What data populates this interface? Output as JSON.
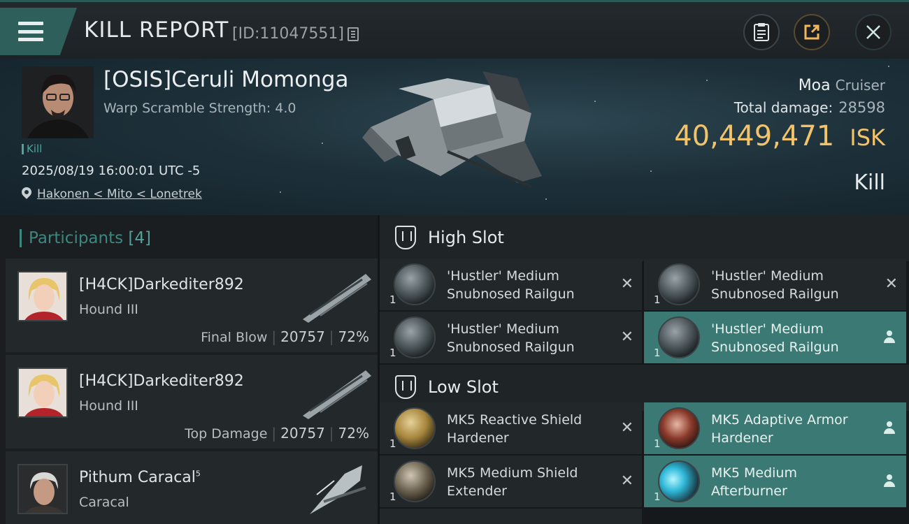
{
  "topbar": {
    "title": "KILL REPORT",
    "report_id": "[ID:11047551]"
  },
  "victim": {
    "name": "[OSIS]Ceruli Momonga",
    "warp_scramble": "Warp Scramble Strength: 4.0",
    "tag": "Kill",
    "timestamp": "2025/08/19 16:00:01 UTC -5",
    "location": "Hakonen < Mito < Lonetrek",
    "ship_name": "Moa",
    "ship_class": "Cruiser",
    "damage_label": "Total damage:",
    "damage_value": "28598",
    "isk_value": "40,449,471",
    "isk_unit": "ISK",
    "result": "Kill"
  },
  "participants": {
    "label": "Participants",
    "count": "[4]",
    "items": [
      {
        "name": "[H4CK]Darkediter892",
        "ship": "Hound III",
        "label": "Final Blow",
        "damage": "20757",
        "percent": "72%"
      },
      {
        "name": "[H4CK]Darkediter892",
        "ship": "Hound III",
        "label": "Top Damage",
        "damage": "20757",
        "percent": "72%"
      },
      {
        "name": "Pithum Caracal",
        "name_sup": "5",
        "ship": "Caracal"
      }
    ]
  },
  "slots": {
    "high": {
      "title": "High Slot",
      "modules": [
        {
          "qty": "1",
          "name": "'Hustler' Medium Snubnosed Railgun",
          "status": "destroyed"
        },
        {
          "qty": "1",
          "name": "'Hustler' Medium Snubnosed Railgun",
          "status": "destroyed"
        },
        {
          "qty": "1",
          "name": "'Hustler' Medium Snubnosed Railgun",
          "status": "destroyed"
        },
        {
          "qty": "1",
          "name": "'Hustler' Medium Snubnosed Railgun",
          "status": "dropped"
        }
      ]
    },
    "low": {
      "title": "Low Slot",
      "modules": [
        {
          "qty": "1",
          "name": "MK5 Reactive Shield Hardener",
          "status": "destroyed"
        },
        {
          "qty": "1",
          "name": "MK5 Adaptive Armor Hardener",
          "status": "dropped"
        },
        {
          "qty": "1",
          "name": "MK5 Medium Shield Extender",
          "status": "destroyed"
        },
        {
          "qty": "1",
          "name": "MK5 Medium Afterburner",
          "status": "dropped"
        }
      ]
    }
  },
  "colors": {
    "accent": "#3b7a74",
    "isk": "#f1c36b",
    "menu": "#2f5f5b"
  }
}
